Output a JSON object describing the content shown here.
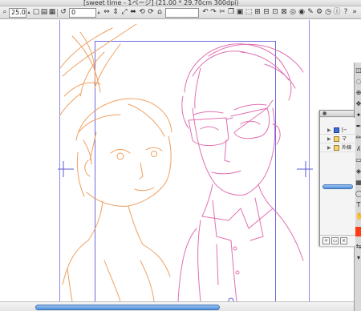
{
  "window": {
    "title": "[sweet time - 1ページ] (21.00 * 29.70cm 300dpi)"
  },
  "toolbar": {
    "zoom_value": "25.0",
    "rotation_value": "0"
  },
  "layers_palette": {
    "rows": [
      {
        "label": "[─",
        "selected": true
      },
      {
        "label": "マ",
        "selected": false
      },
      {
        "label": "外線",
        "selected": false
      }
    ]
  },
  "colors": {
    "accent_blue": "#4e8fd8",
    "sketch_orange": "#f0a060",
    "sketch_pink": "#e070b0",
    "frame_blue": "#6b6be0",
    "current_color": "#ff3b15"
  },
  "icons": {
    "new": "new-document-icon",
    "save": "save-icon",
    "undo": "undo-icon",
    "redo": "redo-icon",
    "hand": "hand-icon",
    "zoom": "zoom-icon"
  }
}
